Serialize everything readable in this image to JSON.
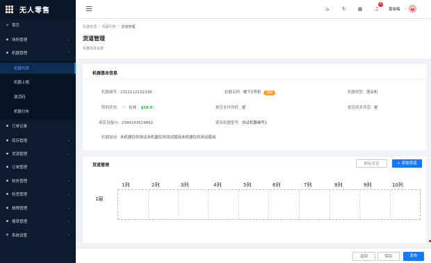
{
  "app": {
    "logo_text": "无人零售"
  },
  "sidebar": {
    "items": [
      {
        "label": "首页",
        "icon": "home-icon"
      },
      {
        "label": "场所管理",
        "icon": "building-icon"
      },
      {
        "label": "机器管理",
        "icon": "machine-icon"
      },
      {
        "label": "订单记录",
        "icon": "order-icon"
      },
      {
        "label": "库存管理",
        "icon": "stock-icon"
      },
      {
        "label": "货源管理",
        "icon": "goods-icon"
      },
      {
        "label": "订单管理",
        "icon": "order-list-icon"
      },
      {
        "label": "财务管理",
        "icon": "finance-icon"
      },
      {
        "label": "检查管理",
        "icon": "check-icon"
      },
      {
        "label": "故障管理",
        "icon": "fault-icon"
      },
      {
        "label": "报表管理",
        "icon": "report-icon"
      },
      {
        "label": "系统设置",
        "icon": "settings-icon"
      }
    ],
    "sub_items": [
      {
        "label": "机器列表",
        "active": true
      },
      {
        "label": "机器上报"
      },
      {
        "label": "激活码"
      },
      {
        "label": "机器分布"
      }
    ]
  },
  "header": {
    "notification_count": "6",
    "user_name": "黄晓梅"
  },
  "breadcrumb": [
    "机器管理",
    "机器列表",
    "货道管理"
  ],
  "page": {
    "title": "货道管理",
    "subtitle": "机器货道设置"
  },
  "machine_info": {
    "title": "机器基本信息",
    "code_label": "机器编号:",
    "code_value": "2312112132338",
    "name_label": "机器名称:",
    "name_value": "楼下1号机",
    "name_tag": "空闲",
    "type_label": "机器类型:",
    "type_value": "混合机",
    "network_label": "联网状态:",
    "network_value": "在线",
    "signal_value": "28.0",
    "remote_label": "是否支持找机:",
    "remote_value": "是",
    "multi_label": "是否层多货道:",
    "multi_value": "是",
    "device_label": "绑定设备ID:",
    "device_value": "2384183524862",
    "model_label": "使用机器型号:",
    "model_value": "测试机器编号1",
    "desc_label": "机器描述:",
    "desc_value": "本机器仅供测试本机器仅供测试使用本机器仅供测试使用"
  },
  "channel": {
    "title": "货道管理",
    "delete_label": "删除货道",
    "add_label": "+ 添加货道",
    "columns": [
      "1列",
      "2列",
      "3列",
      "4列",
      "5列",
      "6列",
      "7列",
      "8列",
      "9列",
      "10列"
    ],
    "rows": [
      "1层"
    ]
  },
  "footer": {
    "back_label": "返回",
    "save_label": "保存",
    "publish_label": "发布"
  },
  "colors": {
    "accent": "#1677ff",
    "sidebar_bg": "#0d1b2e",
    "tag": "#ff9a2e",
    "online": "#2bbb4e"
  }
}
